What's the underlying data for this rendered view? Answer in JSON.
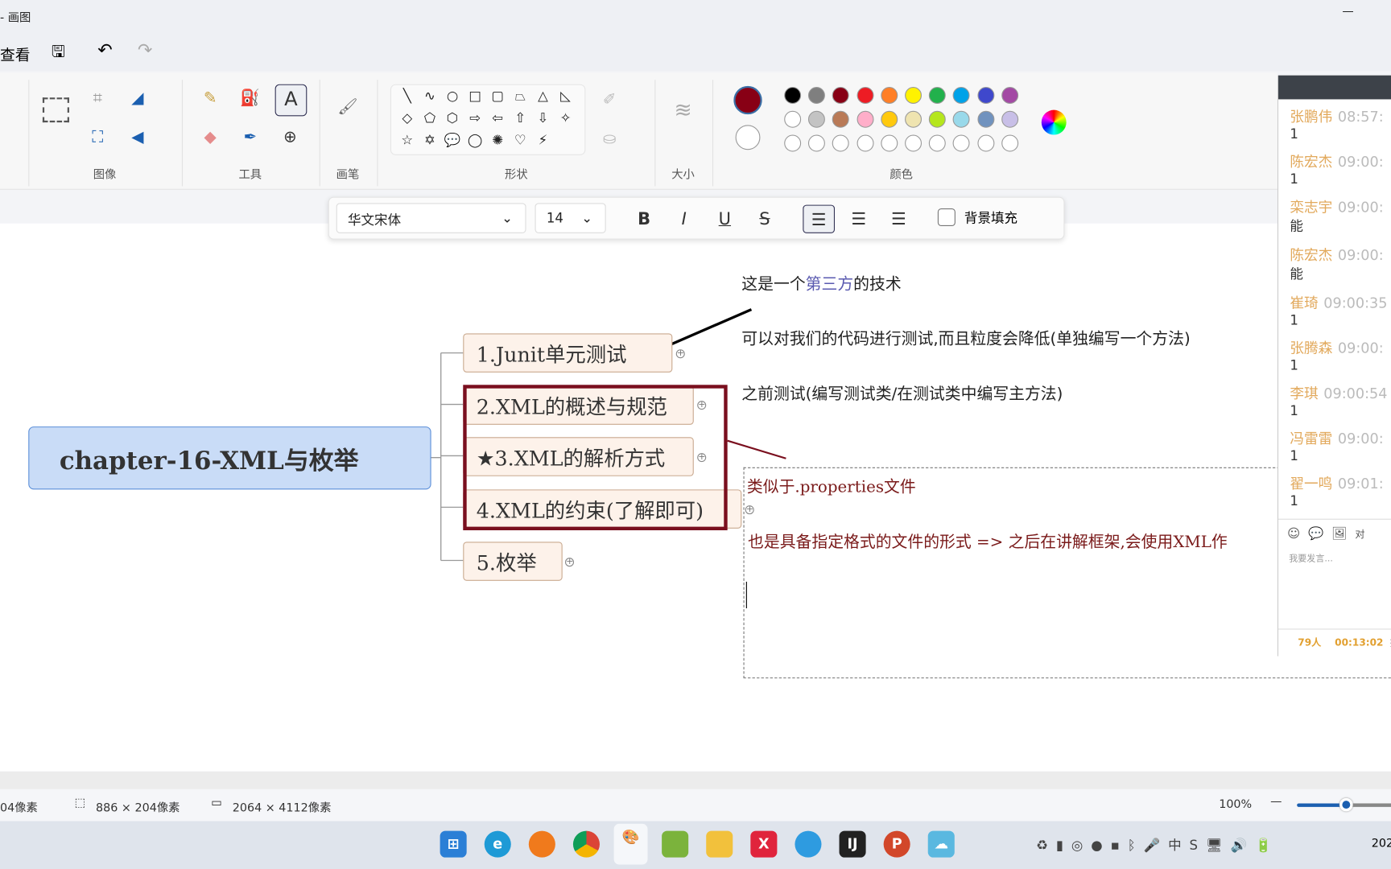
{
  "titlebar": {
    "title": "- 画图",
    "minimize": "—"
  },
  "menubar": {
    "view": "查看"
  },
  "ribbon": {
    "sections": {
      "image": "图像",
      "tools": "工具",
      "brush": "画笔",
      "shapes": "形状",
      "size": "大小",
      "colors": "颜色"
    },
    "shapes": [
      "╲",
      "∿",
      "○",
      "□",
      "▢",
      "⏢",
      "△",
      "◺",
      "◇",
      "⬠",
      "⬡",
      "⇨",
      "⇦",
      "⇧",
      "⇩",
      "✧",
      "☆",
      "✡",
      "💬",
      "◯",
      "✺",
      "♡",
      "⚡"
    ],
    "colors": {
      "primary": "#880015",
      "secondary": "#ffffff",
      "row1": [
        "#000000",
        "#7f7f7f",
        "#880015",
        "#ed1c24",
        "#ff7f27",
        "#fff200",
        "#22b14c",
        "#00a2e8",
        "#3f48cc",
        "#a349a4"
      ],
      "row2": [
        "#ffffff",
        "#c3c3c3",
        "#b97a57",
        "#ffaec9",
        "#ffc90e",
        "#efe4b0",
        "#b5e61d",
        "#99d9ea",
        "#7092be",
        "#c8bfe7"
      ]
    }
  },
  "textbar": {
    "font": "华文宋体",
    "size": "14",
    "bold": "B",
    "italic": "I",
    "underline": "U",
    "strike": "S",
    "bg_fill": "背景填充"
  },
  "mindmap": {
    "root": "chapter-16-XML与枚举",
    "branches": [
      "1.Junit单元测试",
      "2.XML的概述与规范",
      "★3.XML的解析方式",
      "4.XML的约束(了解即可)",
      "5.枚举"
    ]
  },
  "notes": {
    "line1_a": "这是一个",
    "line1_b": "第三方",
    "line1_c": "的技术",
    "line2": "可以对我们的代码进行测试,而且粒度会降低(单独编写一个方法)",
    "line3": "之前测试(编写测试类/在测试类中编写主方法)",
    "box_line1": "类似于.properties文件",
    "box_line2": "也是具备指定格式的文件的形式 => 之后在讲解框架,会使用XML作"
  },
  "chat": {
    "messages": [
      {
        "name": "张鹏伟",
        "time": "08:57:",
        "msg": "1"
      },
      {
        "name": "陈宏杰",
        "time": "09:00:",
        "msg": "1"
      },
      {
        "name": "栾志宇",
        "time": "09:00:",
        "msg": "能"
      },
      {
        "name": "陈宏杰",
        "time": "09:00:",
        "msg": "能"
      },
      {
        "name": "崔琦",
        "time": "09:00:35",
        "msg": "1"
      },
      {
        "name": "张腾森",
        "time": "09:00:",
        "msg": "1"
      },
      {
        "name": "李琪",
        "time": "09:00:54",
        "msg": "1"
      },
      {
        "name": "冯雷雷",
        "time": "09:00:",
        "msg": "1"
      },
      {
        "name": "翟一鸣",
        "time": "09:01:",
        "msg": "1"
      }
    ],
    "placeholder": "我要发言...",
    "to_label": "对",
    "people": "79人",
    "duration": "00:13:02",
    "drop": "掉"
  },
  "status": {
    "cursor": "04像素",
    "selection": "886 × 204像素",
    "canvas": "2064 × 4112像素",
    "zoom": "100%"
  },
  "taskbar": {
    "clock": "202"
  }
}
